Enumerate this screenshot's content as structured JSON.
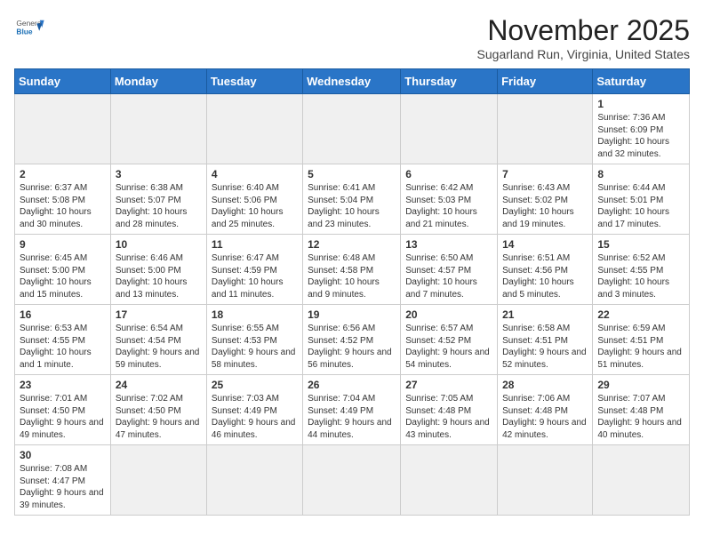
{
  "header": {
    "logo_general": "General",
    "logo_blue": "Blue",
    "title": "November 2025",
    "location": "Sugarland Run, Virginia, United States"
  },
  "weekdays": [
    "Sunday",
    "Monday",
    "Tuesday",
    "Wednesday",
    "Thursday",
    "Friday",
    "Saturday"
  ],
  "weeks": [
    [
      {
        "day": "",
        "info": ""
      },
      {
        "day": "",
        "info": ""
      },
      {
        "day": "",
        "info": ""
      },
      {
        "day": "",
        "info": ""
      },
      {
        "day": "",
        "info": ""
      },
      {
        "day": "",
        "info": ""
      },
      {
        "day": "1",
        "info": "Sunrise: 7:36 AM\nSunset: 6:09 PM\nDaylight: 10 hours and 32 minutes."
      }
    ],
    [
      {
        "day": "2",
        "info": "Sunrise: 6:37 AM\nSunset: 5:08 PM\nDaylight: 10 hours and 30 minutes."
      },
      {
        "day": "3",
        "info": "Sunrise: 6:38 AM\nSunset: 5:07 PM\nDaylight: 10 hours and 28 minutes."
      },
      {
        "day": "4",
        "info": "Sunrise: 6:40 AM\nSunset: 5:06 PM\nDaylight: 10 hours and 25 minutes."
      },
      {
        "day": "5",
        "info": "Sunrise: 6:41 AM\nSunset: 5:04 PM\nDaylight: 10 hours and 23 minutes."
      },
      {
        "day": "6",
        "info": "Sunrise: 6:42 AM\nSunset: 5:03 PM\nDaylight: 10 hours and 21 minutes."
      },
      {
        "day": "7",
        "info": "Sunrise: 6:43 AM\nSunset: 5:02 PM\nDaylight: 10 hours and 19 minutes."
      },
      {
        "day": "8",
        "info": "Sunrise: 6:44 AM\nSunset: 5:01 PM\nDaylight: 10 hours and 17 minutes."
      }
    ],
    [
      {
        "day": "9",
        "info": "Sunrise: 6:45 AM\nSunset: 5:00 PM\nDaylight: 10 hours and 15 minutes."
      },
      {
        "day": "10",
        "info": "Sunrise: 6:46 AM\nSunset: 5:00 PM\nDaylight: 10 hours and 13 minutes."
      },
      {
        "day": "11",
        "info": "Sunrise: 6:47 AM\nSunset: 4:59 PM\nDaylight: 10 hours and 11 minutes."
      },
      {
        "day": "12",
        "info": "Sunrise: 6:48 AM\nSunset: 4:58 PM\nDaylight: 10 hours and 9 minutes."
      },
      {
        "day": "13",
        "info": "Sunrise: 6:50 AM\nSunset: 4:57 PM\nDaylight: 10 hours and 7 minutes."
      },
      {
        "day": "14",
        "info": "Sunrise: 6:51 AM\nSunset: 4:56 PM\nDaylight: 10 hours and 5 minutes."
      },
      {
        "day": "15",
        "info": "Sunrise: 6:52 AM\nSunset: 4:55 PM\nDaylight: 10 hours and 3 minutes."
      }
    ],
    [
      {
        "day": "16",
        "info": "Sunrise: 6:53 AM\nSunset: 4:55 PM\nDaylight: 10 hours and 1 minute."
      },
      {
        "day": "17",
        "info": "Sunrise: 6:54 AM\nSunset: 4:54 PM\nDaylight: 9 hours and 59 minutes."
      },
      {
        "day": "18",
        "info": "Sunrise: 6:55 AM\nSunset: 4:53 PM\nDaylight: 9 hours and 58 minutes."
      },
      {
        "day": "19",
        "info": "Sunrise: 6:56 AM\nSunset: 4:52 PM\nDaylight: 9 hours and 56 minutes."
      },
      {
        "day": "20",
        "info": "Sunrise: 6:57 AM\nSunset: 4:52 PM\nDaylight: 9 hours and 54 minutes."
      },
      {
        "day": "21",
        "info": "Sunrise: 6:58 AM\nSunset: 4:51 PM\nDaylight: 9 hours and 52 minutes."
      },
      {
        "day": "22",
        "info": "Sunrise: 6:59 AM\nSunset: 4:51 PM\nDaylight: 9 hours and 51 minutes."
      }
    ],
    [
      {
        "day": "23",
        "info": "Sunrise: 7:01 AM\nSunset: 4:50 PM\nDaylight: 9 hours and 49 minutes."
      },
      {
        "day": "24",
        "info": "Sunrise: 7:02 AM\nSunset: 4:50 PM\nDaylight: 9 hours and 47 minutes."
      },
      {
        "day": "25",
        "info": "Sunrise: 7:03 AM\nSunset: 4:49 PM\nDaylight: 9 hours and 46 minutes."
      },
      {
        "day": "26",
        "info": "Sunrise: 7:04 AM\nSunset: 4:49 PM\nDaylight: 9 hours and 44 minutes."
      },
      {
        "day": "27",
        "info": "Sunrise: 7:05 AM\nSunset: 4:48 PM\nDaylight: 9 hours and 43 minutes."
      },
      {
        "day": "28",
        "info": "Sunrise: 7:06 AM\nSunset: 4:48 PM\nDaylight: 9 hours and 42 minutes."
      },
      {
        "day": "29",
        "info": "Sunrise: 7:07 AM\nSunset: 4:48 PM\nDaylight: 9 hours and 40 minutes."
      }
    ],
    [
      {
        "day": "30",
        "info": "Sunrise: 7:08 AM\nSunset: 4:47 PM\nDaylight: 9 hours and 39 minutes."
      },
      {
        "day": "",
        "info": ""
      },
      {
        "day": "",
        "info": ""
      },
      {
        "day": "",
        "info": ""
      },
      {
        "day": "",
        "info": ""
      },
      {
        "day": "",
        "info": ""
      },
      {
        "day": "",
        "info": ""
      }
    ]
  ]
}
